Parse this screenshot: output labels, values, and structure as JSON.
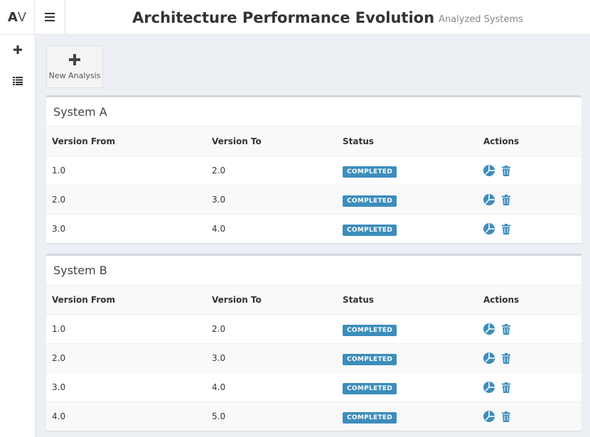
{
  "header": {
    "logo_a": "A",
    "logo_v": "V",
    "title": "Architecture Performance Evolution",
    "subtitle": "Analyzed Systems"
  },
  "sidebar": {
    "items": [
      {
        "icon": "plus-icon"
      },
      {
        "icon": "list-icon"
      }
    ]
  },
  "toolbar": {
    "new_analysis_label": "New Analysis"
  },
  "table_headers": {
    "from": "Version From",
    "to": "Version To",
    "status": "Status",
    "actions": "Actions"
  },
  "systems": [
    {
      "name": "System A",
      "rows": [
        {
          "from": "1.0",
          "to": "2.0",
          "status": "COMPLETED"
        },
        {
          "from": "2.0",
          "to": "3.0",
          "status": "COMPLETED"
        },
        {
          "from": "3.0",
          "to": "4.0",
          "status": "COMPLETED"
        }
      ]
    },
    {
      "name": "System B",
      "rows": [
        {
          "from": "1.0",
          "to": "2.0",
          "status": "COMPLETED"
        },
        {
          "from": "2.0",
          "to": "3.0",
          "status": "COMPLETED"
        },
        {
          "from": "3.0",
          "to": "4.0",
          "status": "COMPLETED"
        },
        {
          "from": "4.0",
          "to": "5.0",
          "status": "COMPLETED"
        }
      ]
    }
  ],
  "colors": {
    "accent": "#3c8dbc",
    "background": "#ecf0f5"
  }
}
